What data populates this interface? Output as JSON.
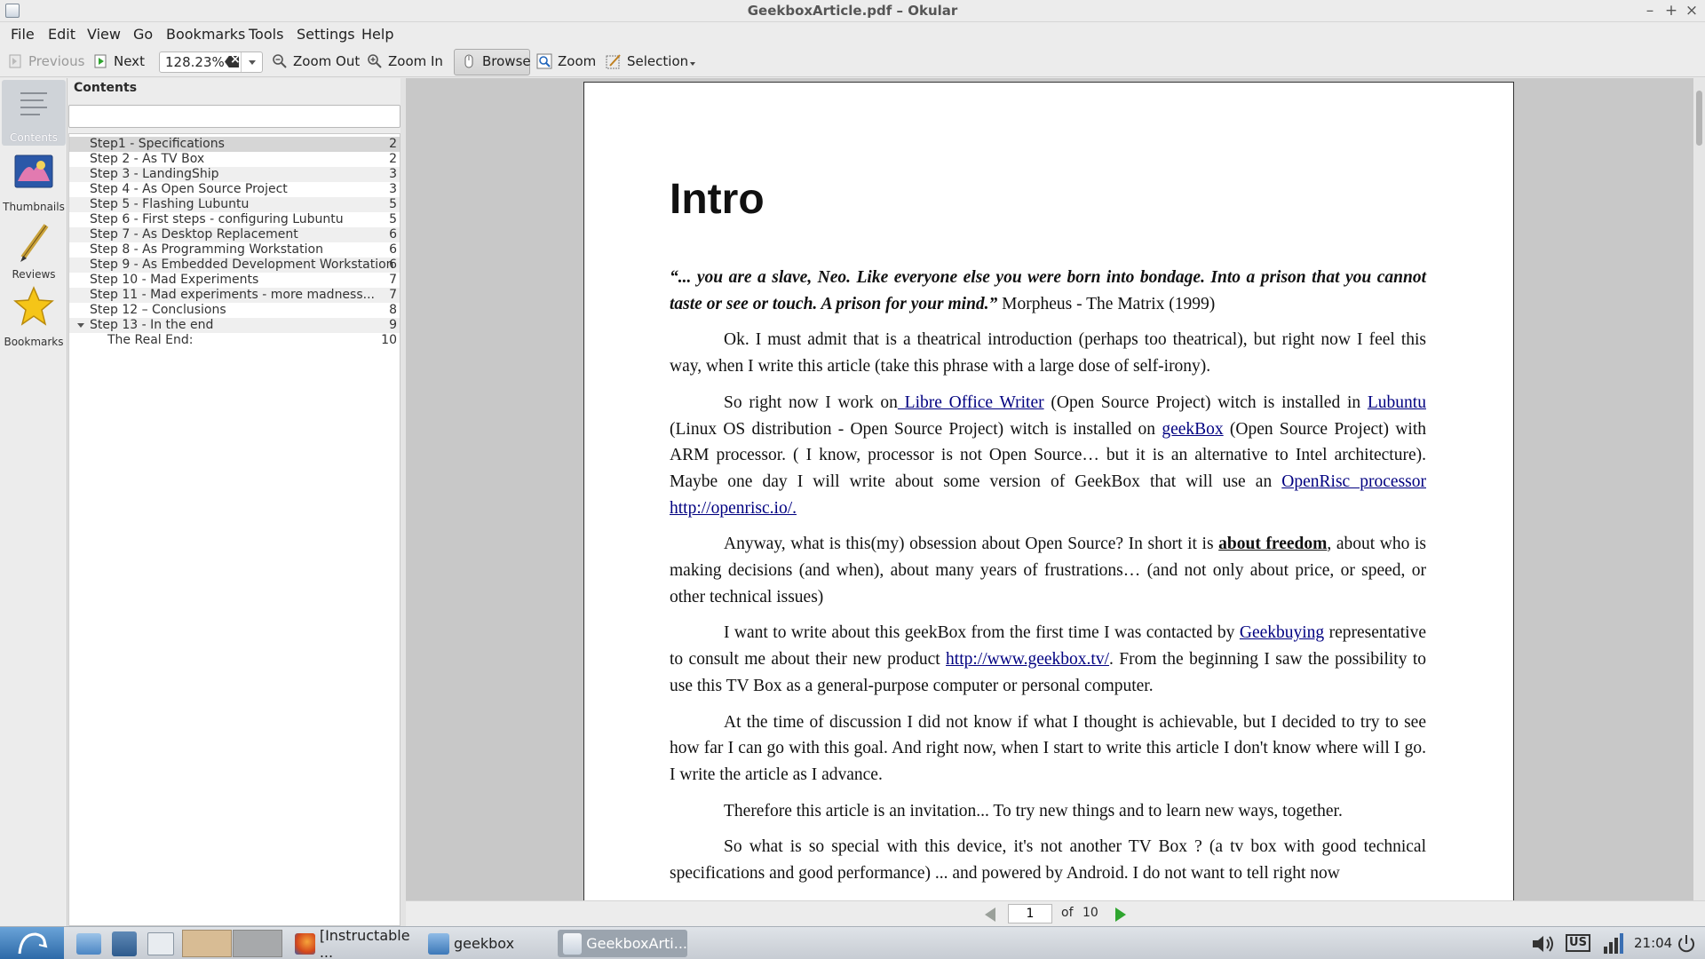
{
  "window": {
    "title": "GeekboxArticle.pdf – Okular"
  },
  "menu": [
    "File",
    "Edit",
    "View",
    "Go",
    "Bookmarks",
    "Tools",
    "Settings",
    "Help"
  ],
  "toolbar": {
    "previous": "Previous",
    "next": "Next",
    "zoom_value": "128.23%",
    "zoom_out": "Zoom Out",
    "zoom_in": "Zoom In",
    "browse": "Browse",
    "zoom": "Zoom",
    "selection": "Selection"
  },
  "sidebar": {
    "items": [
      {
        "label": "Contents",
        "icon": "contents-icon",
        "active": true
      },
      {
        "label": "Thumbnails",
        "icon": "thumbnails-icon",
        "active": false
      },
      {
        "label": "Reviews",
        "icon": "pencil-icon",
        "active": false
      },
      {
        "label": "Bookmarks",
        "icon": "star-icon",
        "active": false
      }
    ]
  },
  "contents": {
    "title": "Contents",
    "search_value": "",
    "entries": [
      {
        "title": "Step1 - Specifications",
        "page": "2"
      },
      {
        "title": "Step 2 - As TV Box",
        "page": "2"
      },
      {
        "title": "Step 3 - LandingShip",
        "page": "3"
      },
      {
        "title": "Step 4 - As Open Source Project",
        "page": "3"
      },
      {
        "title": "Step 5 - Flashing Lubuntu",
        "page": "5"
      },
      {
        "title": "Step 6 - First steps - configuring Lubuntu",
        "page": "5"
      },
      {
        "title": "Step 7 - As Desktop Replacement",
        "page": "6"
      },
      {
        "title": "Step 8 - As Programming Workstation",
        "page": "6"
      },
      {
        "title": "Step 9 - As Embedded Development Workstation",
        "page": "6"
      },
      {
        "title": "Step 10 - Mad Experiments",
        "page": "7"
      },
      {
        "title": "Step 11 - Mad experiments - more madness...",
        "page": "7"
      },
      {
        "title": "Step 12 – Conclusions",
        "page": "8"
      },
      {
        "title": "Step 13 - In the end",
        "page": "9"
      },
      {
        "title": "The Real End:",
        "page": "10"
      }
    ]
  },
  "document": {
    "heading": "Intro",
    "quote": "“... you are a slave, Neo. Like everyone else you were born into bondage. Into a prison that you cannot taste or see or touch. A prison for your mind.”",
    "quote_attribution": " Morpheus - The Matrix (1999)",
    "p1": "Ok. I must admit that is a theatrical introduction (perhaps too theatrical), but right now I feel this way, when I write this article (take this phrase with a large dose of self-irony).",
    "p2_a": "So right now I work on",
    "p2_link1": " Libre Office Writer",
    "p2_b": " (Open Source Project) witch is installed in ",
    "p2_link2": "Lubuntu",
    "p2_c": " (Linux OS distribution - Open Source Project) witch is installed on ",
    "p2_link3": "geekBox",
    "p2_d": " (Open Source Project) with ARM processor. ( I know, processor is not Open Source… but it is an alternative to Intel architecture). Maybe one day I will write about some version of GeekBox that will use an ",
    "p2_link4": "OpenRisc processor",
    "p2_e": " ",
    "p2_link5": "http://openrisc.io/.",
    "p3_a": "Anyway, what is this(my) obsession about Open Source? In short it is ",
    "p3_bold": "about freedom",
    "p3_b": ", about who is making decisions (and when), about many years of frustrations… (and not only about price, or speed, or other technical issues)",
    "p4_a": "I want to write about this geekBox from the first time I was contacted by ",
    "p4_link1": "Geekbuying",
    "p4_b": " representative to consult me about their new product ",
    "p4_link2": "http://www.geekbox.tv/",
    "p4_c": ". From the beginning I saw the possibility to use this TV Box as a general-purpose computer or personal computer.",
    "p5": "At the time of discussion I did not know if what I thought is achievable, but I decided to try to see how far I can go with this goal. And right now, when I start to write this article I don't know where will I go. I write the article as I advance.",
    "p6": "Therefore this article is an invitation... To try new things and to learn new ways, together.",
    "p7": "So what is so special with this device, it's not another TV Box ? (a tv box with good technical specifications and good performance) ... and powered by Android. I do not want to tell right now"
  },
  "pagenav": {
    "current": "1",
    "of": "of",
    "total": "10"
  },
  "taskbar": {
    "tasks": [
      {
        "label": "[Instructable ...",
        "icon": "firefox-icon"
      },
      {
        "label": "geekbox",
        "icon": "folder-icon"
      },
      {
        "label": "GeekboxArti...",
        "icon": "okular-icon",
        "active": true
      }
    ],
    "keyboard_layout": "US",
    "time": "21:04"
  }
}
